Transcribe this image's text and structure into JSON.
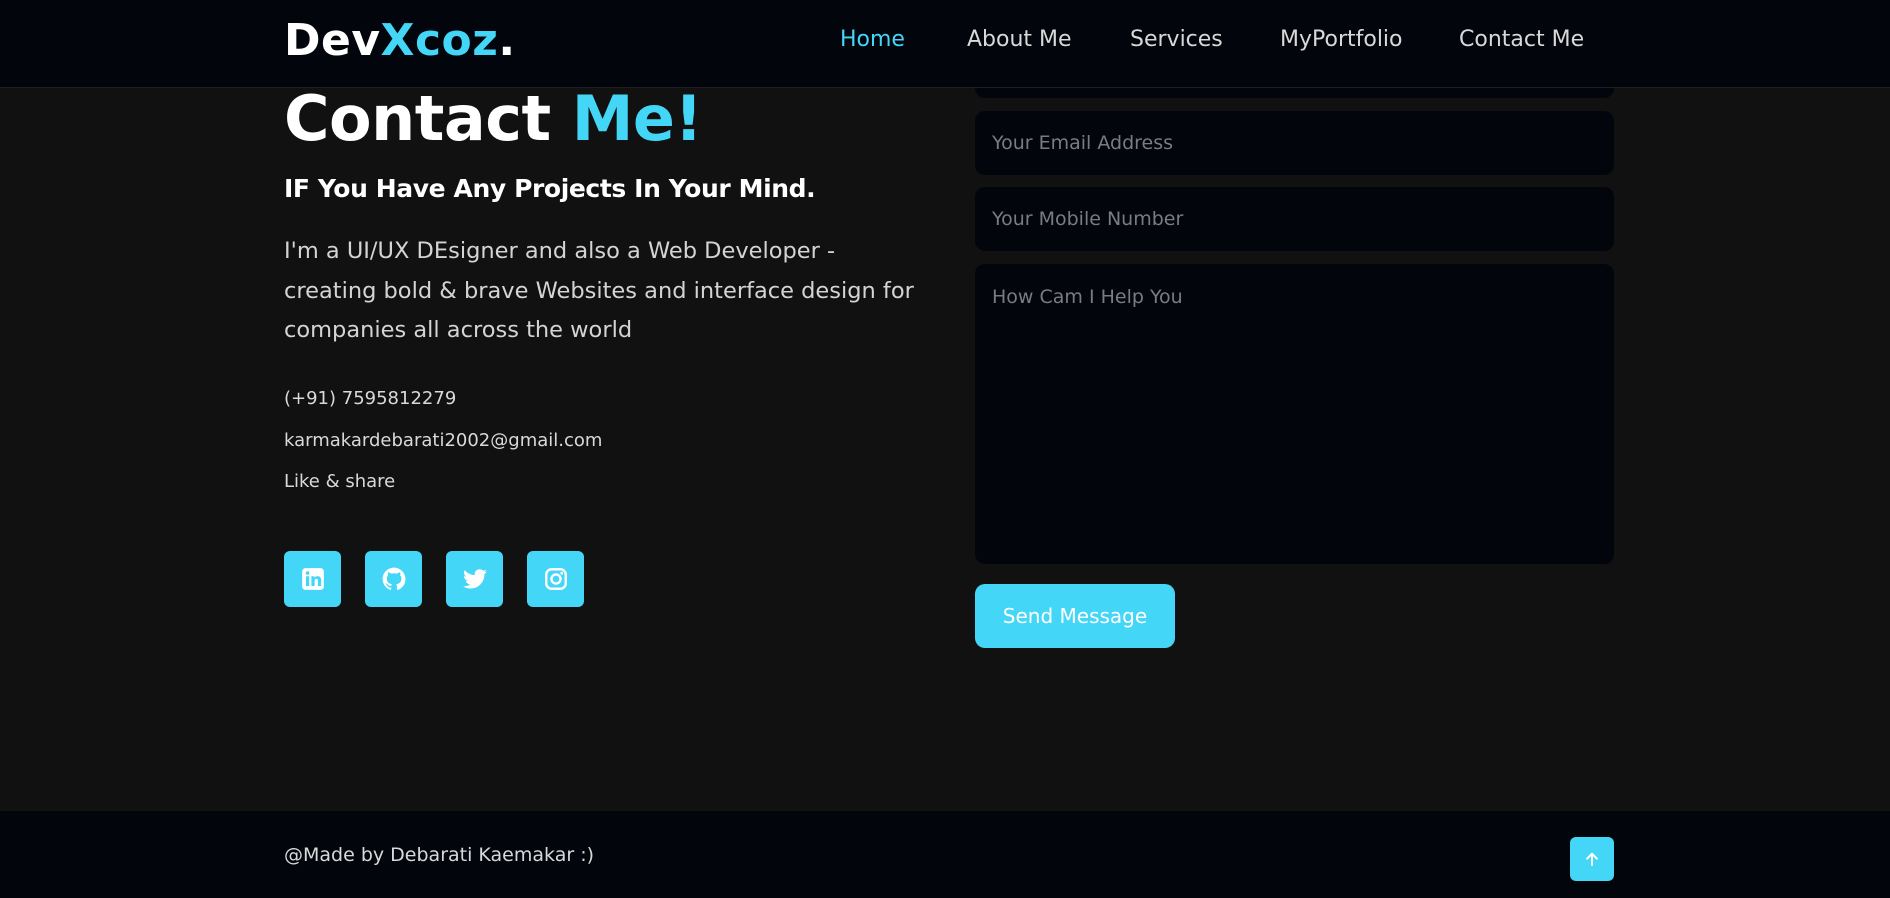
{
  "header": {
    "logo": {
      "prefix": "Dev",
      "accent": "Xcoz",
      "suffix": "."
    },
    "nav": [
      {
        "label": "Home",
        "active": true
      },
      {
        "label": "About Me",
        "active": false
      },
      {
        "label": "Services",
        "active": false
      },
      {
        "label": "MyPortfolio",
        "active": false
      },
      {
        "label": "Contact Me",
        "active": false
      }
    ]
  },
  "contact": {
    "title_main": "Contact",
    "title_accent": "Me!",
    "subtitle": "IF You Have Any Projects In Your Mind.",
    "description": "I'm a UI/UX DEsigner and also a Web Developer - creating bold & brave Websites and interface design for companies all across the world",
    "phone": "(+91) 7595812279",
    "email": "karmakardebarati2002@gmail.com",
    "share_label": "Like & share",
    "socials": [
      {
        "icon": "linkedin-icon"
      },
      {
        "icon": "github-icon"
      },
      {
        "icon": "twitter-icon"
      },
      {
        "icon": "instagram-icon"
      }
    ]
  },
  "form": {
    "email_placeholder": "Your Email Address",
    "mobile_placeholder": "Your Mobile Number",
    "message_placeholder": "How Cam I Help You",
    "send_label": "Send Message"
  },
  "footer": {
    "credit": "@Made by Debarati Kaemakar :)",
    "to_top_icon": "arrow-up-icon"
  },
  "colors": {
    "accent": "#44d6f7",
    "background": "#111111",
    "panel": "#02050b"
  }
}
